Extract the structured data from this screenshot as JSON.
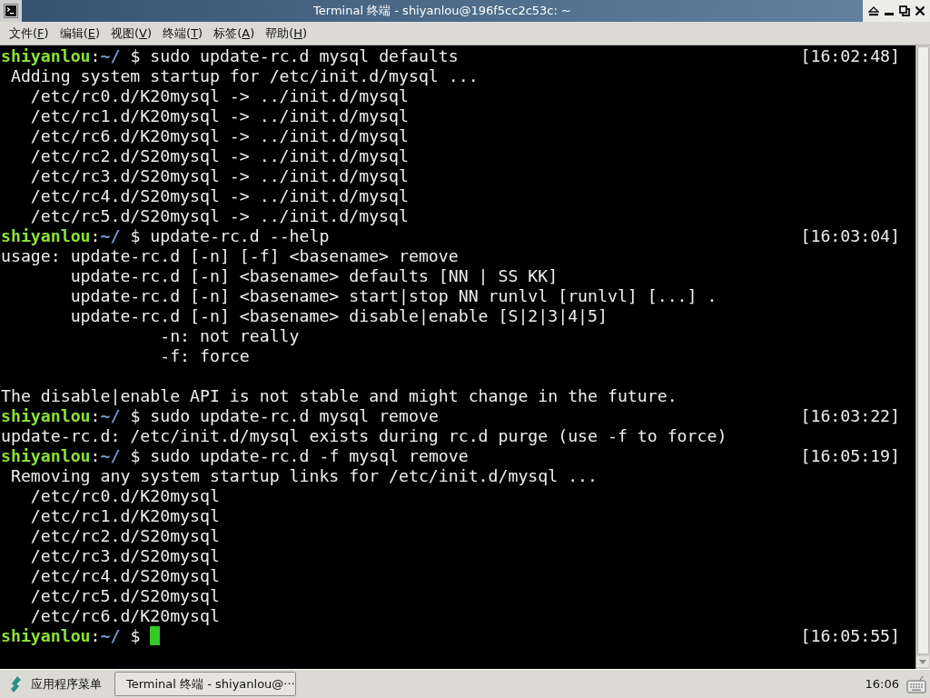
{
  "window": {
    "title": "Terminal 终端 - shiyanlou@196f5cc2c53c: ~"
  },
  "menu_bar": [
    {
      "text": "文件(",
      "mnemonic": "F",
      "rest": ")"
    },
    {
      "text": "编辑(",
      "mnemonic": "E",
      "rest": ")"
    },
    {
      "text": "视图(",
      "mnemonic": "V",
      "rest": ")"
    },
    {
      "text": "终端(",
      "mnemonic": "T",
      "rest": ")"
    },
    {
      "text": "标签(",
      "mnemonic": "A",
      "rest": ")"
    },
    {
      "text": "帮助(",
      "mnemonic": "H",
      "rest": ")"
    }
  ],
  "terminal": {
    "lines": [
      {
        "kind": "prompt",
        "user": "shiyanlou",
        "separator": ":",
        "path": "~/",
        "symbol": "$",
        "command": "sudo update-rc.d mysql defaults",
        "time": "[16:02:48]",
        "cursor": false
      },
      {
        "kind": "output",
        "text": " Adding system startup for /etc/init.d/mysql ..."
      },
      {
        "kind": "output",
        "text": "   /etc/rc0.d/K20mysql -> ../init.d/mysql"
      },
      {
        "kind": "output",
        "text": "   /etc/rc1.d/K20mysql -> ../init.d/mysql"
      },
      {
        "kind": "output",
        "text": "   /etc/rc6.d/K20mysql -> ../init.d/mysql"
      },
      {
        "kind": "output",
        "text": "   /etc/rc2.d/S20mysql -> ../init.d/mysql"
      },
      {
        "kind": "output",
        "text": "   /etc/rc3.d/S20mysql -> ../init.d/mysql"
      },
      {
        "kind": "output",
        "text": "   /etc/rc4.d/S20mysql -> ../init.d/mysql"
      },
      {
        "kind": "output",
        "text": "   /etc/rc5.d/S20mysql -> ../init.d/mysql"
      },
      {
        "kind": "prompt",
        "user": "shiyanlou",
        "separator": ":",
        "path": "~/",
        "symbol": "$",
        "command": "update-rc.d --help",
        "time": "[16:03:04]",
        "cursor": false
      },
      {
        "kind": "output",
        "text": "usage: update-rc.d [-n] [-f] <basename> remove"
      },
      {
        "kind": "output",
        "text": "       update-rc.d [-n] <basename> defaults [NN | SS KK]"
      },
      {
        "kind": "output",
        "text": "       update-rc.d [-n] <basename> start|stop NN runlvl [runlvl] [...] ."
      },
      {
        "kind": "output",
        "text": "       update-rc.d [-n] <basename> disable|enable [S|2|3|4|5]"
      },
      {
        "kind": "output",
        "text": "                -n: not really"
      },
      {
        "kind": "output",
        "text": "                -f: force"
      },
      {
        "kind": "blank"
      },
      {
        "kind": "output",
        "text": "The disable|enable API is not stable and might change in the future."
      },
      {
        "kind": "prompt",
        "user": "shiyanlou",
        "separator": ":",
        "path": "~/",
        "symbol": "$",
        "command": "sudo update-rc.d mysql remove",
        "time": "[16:03:22]",
        "cursor": false
      },
      {
        "kind": "output",
        "text": "update-rc.d: /etc/init.d/mysql exists during rc.d purge (use -f to force)"
      },
      {
        "kind": "prompt",
        "user": "shiyanlou",
        "separator": ":",
        "path": "~/",
        "symbol": "$",
        "command": "sudo update-rc.d -f mysql remove",
        "time": "[16:05:19]",
        "cursor": false
      },
      {
        "kind": "output",
        "text": " Removing any system startup links for /etc/init.d/mysql ..."
      },
      {
        "kind": "output",
        "text": "   /etc/rc0.d/K20mysql"
      },
      {
        "kind": "output",
        "text": "   /etc/rc1.d/K20mysql"
      },
      {
        "kind": "output",
        "text": "   /etc/rc2.d/S20mysql"
      },
      {
        "kind": "output",
        "text": "   /etc/rc3.d/S20mysql"
      },
      {
        "kind": "output",
        "text": "   /etc/rc4.d/S20mysql"
      },
      {
        "kind": "output",
        "text": "   /etc/rc5.d/S20mysql"
      },
      {
        "kind": "output",
        "text": "   /etc/rc6.d/K20mysql"
      },
      {
        "kind": "prompt",
        "user": "shiyanlou",
        "separator": ":",
        "path": "~/",
        "symbol": "$",
        "time": "[16:05:55]",
        "cursor": true
      }
    ]
  },
  "taskbar": {
    "app_menu": "应用程序菜单",
    "tasks": [
      {
        "label": "Terminal 终端 - shiyanlou@···",
        "selected": true
      }
    ],
    "clock": "16:06"
  }
}
